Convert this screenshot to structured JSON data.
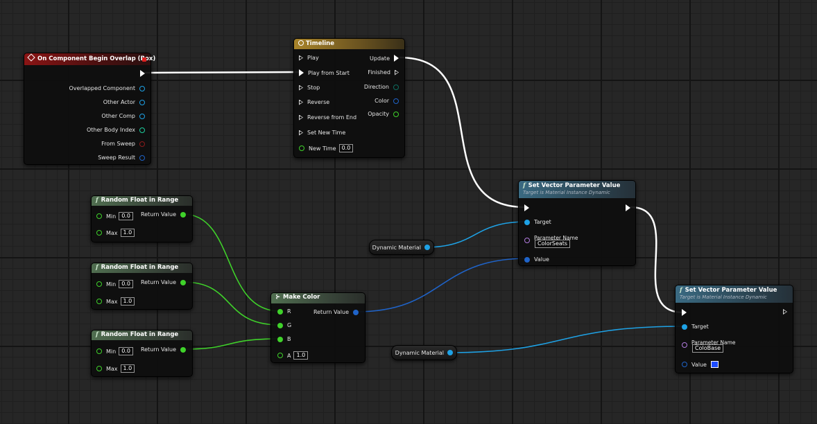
{
  "colors": {
    "exec": "#ffffff",
    "object": "#1ea2e6",
    "float": "#3fd22a",
    "struct": "#1f63c8",
    "name": "#b27ce0",
    "bool": "#8e1b1b",
    "int": "#1ecf9e",
    "swatch": "#1d4cff"
  },
  "event_node": {
    "title": "On Component Begin Overlap (Box)",
    "outputs": [
      "Overlapped Component",
      "Other Actor",
      "Other Comp",
      "Other Body Index",
      "From Sweep",
      "Sweep Result"
    ]
  },
  "timeline_node": {
    "title": "Timeline",
    "inputs": [
      "Play",
      "Play from Start",
      "Stop",
      "Reverse",
      "Reverse from End",
      "Set New Time"
    ],
    "new_time_label": "New Time",
    "new_time_value": "0.0",
    "outputs": [
      "Update",
      "Finished",
      "Direction",
      "Color",
      "Opacity"
    ]
  },
  "random_nodes": [
    {
      "title": "Random Float in Range",
      "min_label": "Min",
      "min": "0.0",
      "max_label": "Max",
      "max": "1.0",
      "out": "Return Value"
    },
    {
      "title": "Random Float in Range",
      "min_label": "Min",
      "min": "0.0",
      "max_label": "Max",
      "max": "1.0",
      "out": "Return Value"
    },
    {
      "title": "Random Float in Range",
      "min_label": "Min",
      "min": "0.0",
      "max_label": "Max",
      "max": "1.0",
      "out": "Return Value"
    }
  ],
  "make_color": {
    "title": "Make Color",
    "inputs": [
      "R",
      "G",
      "B"
    ],
    "a_label": "A",
    "a_value": "1.0",
    "out": "Return Value"
  },
  "dyn_mat_1": {
    "label": "Dynamic Material"
  },
  "dyn_mat_2": {
    "label": "Dynamic Material"
  },
  "set_vec_1": {
    "title": "Set Vector Parameter Value",
    "subtitle": "Target is Material Instance Dynamic",
    "target": "Target",
    "param_label": "Parameter Name",
    "param_value": "ColorSeats",
    "value": "Value"
  },
  "set_vec_2": {
    "title": "Set Vector Parameter Value",
    "subtitle": "Target is Material Instance Dynamic",
    "target": "Target",
    "param_label": "Parameter Name",
    "param_value": "ColoBase",
    "value": "Value"
  }
}
